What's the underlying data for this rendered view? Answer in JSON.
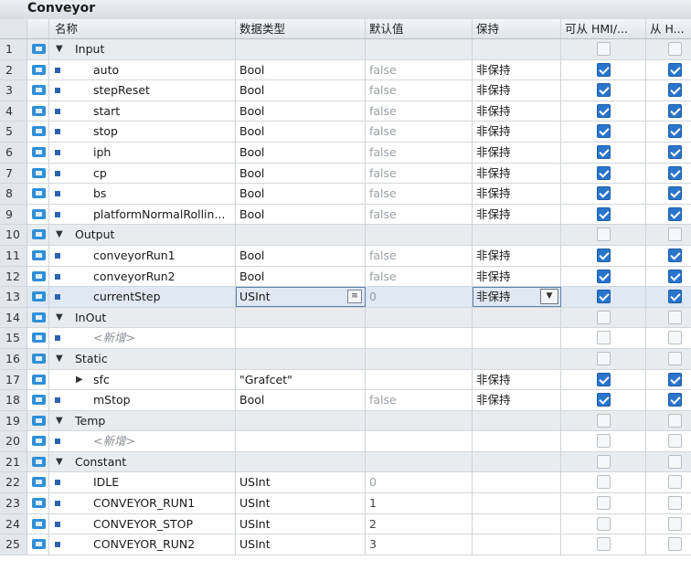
{
  "block_title": "Conveyor",
  "columns": {
    "name": "名称",
    "datatype": "数据类型",
    "default": "默认值",
    "retain": "保持",
    "hmi_access": "可从 HMI/...",
    "hmi_from": "从 H..."
  },
  "icons": {
    "interface_row": "interface-row-icon",
    "expand": "expand-triangle-icon",
    "collapse": "collapse-triangle-icon",
    "bullet": "variable-bullet-icon"
  },
  "rows": [
    {
      "num": "1",
      "name": "Input",
      "type": "",
      "default": "",
      "retain": "",
      "hmi": "off",
      "from": "off",
      "group": true
    },
    {
      "num": "2",
      "name": "auto",
      "type": "Bool",
      "default": "false",
      "retain": "非保持",
      "hmi": "on",
      "from": "on"
    },
    {
      "num": "3",
      "name": "stepReset",
      "type": "Bool",
      "default": "false",
      "retain": "非保持",
      "hmi": "on",
      "from": "on"
    },
    {
      "num": "4",
      "name": "start",
      "type": "Bool",
      "default": "false",
      "retain": "非保持",
      "hmi": "on",
      "from": "on"
    },
    {
      "num": "5",
      "name": "stop",
      "type": "Bool",
      "default": "false",
      "retain": "非保持",
      "hmi": "on",
      "from": "on"
    },
    {
      "num": "6",
      "name": "iph",
      "type": "Bool",
      "default": "false",
      "retain": "非保持",
      "hmi": "on",
      "from": "on"
    },
    {
      "num": "7",
      "name": "cp",
      "type": "Bool",
      "default": "false",
      "retain": "非保持",
      "hmi": "on",
      "from": "on"
    },
    {
      "num": "8",
      "name": "bs",
      "type": "Bool",
      "default": "false",
      "retain": "非保持",
      "hmi": "on",
      "from": "on"
    },
    {
      "num": "9",
      "name": "platformNormalRollin...",
      "type": "Bool",
      "default": "false",
      "retain": "非保持",
      "hmi": "on",
      "from": "on"
    },
    {
      "num": "10",
      "name": "Output",
      "type": "",
      "default": "",
      "retain": "",
      "hmi": "off",
      "from": "off",
      "group": true
    },
    {
      "num": "11",
      "name": "conveyorRun1",
      "type": "Bool",
      "default": "false",
      "retain": "非保持",
      "hmi": "on",
      "from": "on"
    },
    {
      "num": "12",
      "name": "conveyorRun2",
      "type": "Bool",
      "default": "false",
      "retain": "非保持",
      "hmi": "on",
      "from": "on"
    },
    {
      "num": "13",
      "name": "currentStep",
      "type": "USInt",
      "default": "0",
      "retain": "非保持",
      "hmi": "on",
      "from": "on",
      "selected": true
    },
    {
      "num": "14",
      "name": "InOut",
      "type": "",
      "default": "",
      "retain": "",
      "hmi": "off",
      "from": "off",
      "group": true
    },
    {
      "num": "15",
      "name": "<新增>",
      "type": "",
      "default": "",
      "retain": "",
      "hmi": "off",
      "from": "off",
      "addnew": true
    },
    {
      "num": "16",
      "name": "Static",
      "type": "",
      "default": "",
      "retain": "",
      "hmi": "off",
      "from": "off",
      "group": true
    },
    {
      "num": "17",
      "name": "sfc",
      "type": "\"Grafcet\"",
      "default": "",
      "retain": "非保持",
      "hmi": "on",
      "from": "on",
      "subexpand": true
    },
    {
      "num": "18",
      "name": "mStop",
      "type": "Bool",
      "default": "false",
      "retain": "非保持",
      "hmi": "on",
      "from": "on"
    },
    {
      "num": "19",
      "name": "Temp",
      "type": "",
      "default": "",
      "retain": "",
      "hmi": "off",
      "from": "off",
      "group": true
    },
    {
      "num": "20",
      "name": "<新增>",
      "type": "",
      "default": "",
      "retain": "",
      "hmi": "off",
      "from": "off",
      "addnew": true
    },
    {
      "num": "21",
      "name": "Constant",
      "type": "",
      "default": "",
      "retain": "",
      "hmi": "off",
      "from": "off",
      "group": true
    },
    {
      "num": "22",
      "name": "IDLE",
      "type": "USInt",
      "default": "0",
      "retain": "",
      "hmi": "off",
      "from": "off"
    },
    {
      "num": "23",
      "name": "CONVEYOR_RUN1",
      "type": "USInt",
      "default": "1",
      "retain": "",
      "hmi": "off",
      "from": "off",
      "dark": true
    },
    {
      "num": "24",
      "name": "CONVEYOR_STOP",
      "type": "USInt",
      "default": "2",
      "retain": "",
      "hmi": "off",
      "from": "off",
      "dark": true
    },
    {
      "num": "25",
      "name": "CONVEYOR_RUN2",
      "type": "USInt",
      "default": "3",
      "retain": "",
      "hmi": "off",
      "from": "off",
      "dark": true
    }
  ]
}
